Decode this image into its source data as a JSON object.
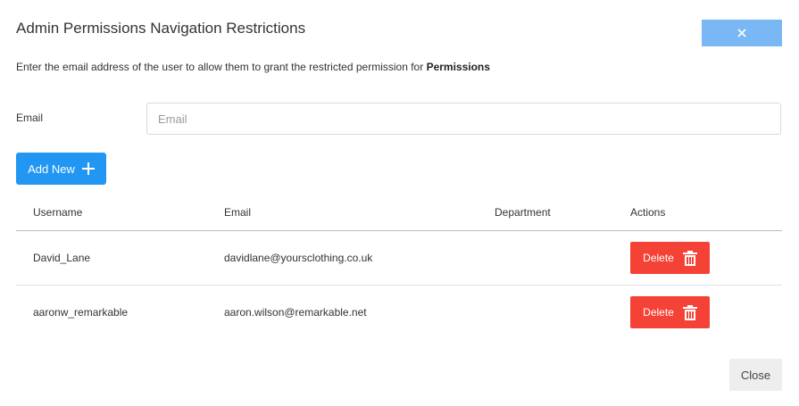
{
  "dialog": {
    "title": "Admin Permissions Navigation Restrictions",
    "instructions_prefix": "Enter the email address of the user to allow them to grant the restricted permission for ",
    "instructions_bold": "Permissions"
  },
  "form": {
    "email_label": "Email",
    "email_placeholder": "Email",
    "email_value": "",
    "add_label": "Add New"
  },
  "table": {
    "headers": [
      "Username",
      "Email",
      "Department",
      "Actions"
    ],
    "rows": [
      {
        "username": "David_Lane",
        "email": "davidlane@yoursclothing.co.uk",
        "department": "",
        "action_label": "Delete"
      },
      {
        "username": "aaronw_remarkable",
        "email": "aaron.wilson@remarkable.net",
        "department": "",
        "action_label": "Delete"
      }
    ]
  },
  "footer": {
    "close_label": "Close"
  },
  "icons": {
    "dismiss": "close-icon",
    "add": "plus-icon",
    "delete": "trash-icon"
  },
  "colors": {
    "primary": "#2196f3",
    "dismiss": "#7ab8f5",
    "danger": "#f44336",
    "neutral": "#eeeeee"
  }
}
